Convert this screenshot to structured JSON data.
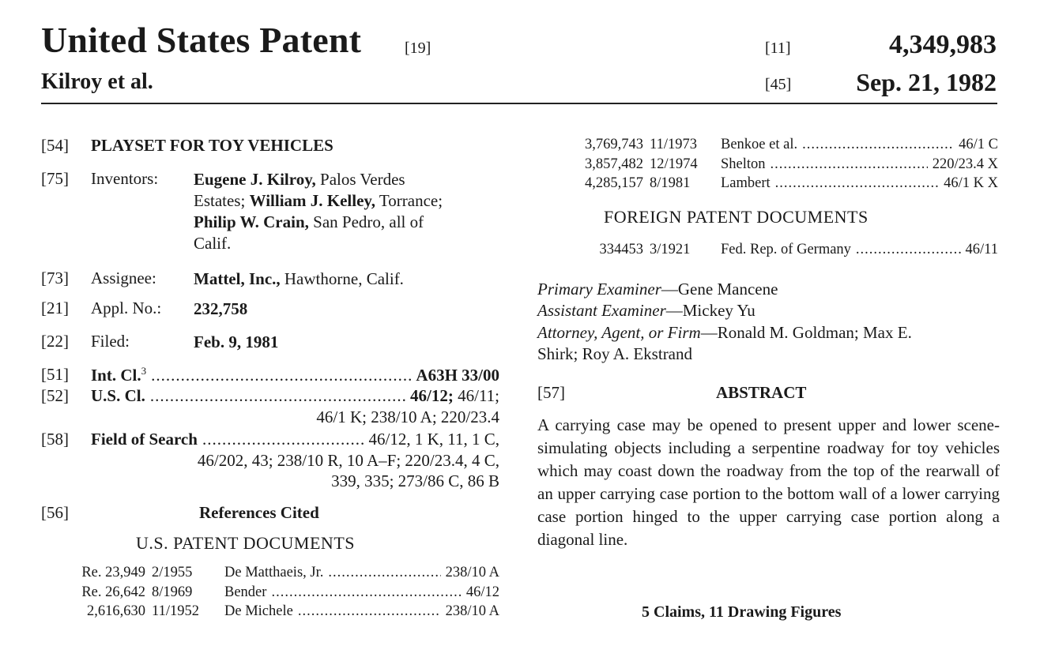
{
  "header": {
    "title": "United States Patent",
    "title_code": "[19]",
    "inventor_short": "Kilroy et al.",
    "code_11": "[11]",
    "patent_number": "4,349,983",
    "code_45": "[45]",
    "patent_date": "Sep. 21, 1982"
  },
  "fields": {
    "title": {
      "code": "[54]",
      "text": "PLAYSET FOR TOY VEHICLES"
    },
    "inventors": {
      "code": "[75]",
      "label": "Inventors:",
      "n1": "Eugene J. Kilroy,",
      "t1": " Palos Verdes",
      "t2": "Estates; ",
      "n2": "William J. Kelley,",
      "t3": " Torrance;",
      "n3": "Philip W. Crain,",
      "t4": " San Pedro, all of",
      "t5": "Calif."
    },
    "assignee": {
      "code": "[73]",
      "label": "Assignee:",
      "name": "Mattel, Inc.,",
      "rest": " Hawthorne, Calif."
    },
    "appl_no": {
      "code": "[21]",
      "label": "Appl. No.:",
      "value": "232,758"
    },
    "filed": {
      "code": "[22]",
      "label": "Filed:",
      "value": "Feb. 9, 1981"
    },
    "int_cl": {
      "code": "[51]",
      "label": "Int. Cl.",
      "sup": "3",
      "value": "A63H 33/00"
    },
    "us_cl": {
      "code": "[52]",
      "label": "U.S. Cl.",
      "value_bold": "46/12;",
      "value_rest": " 46/11;",
      "line2": "46/1 K; 238/10 A; 220/23.4"
    },
    "search": {
      "code": "[58]",
      "label": "Field of Search",
      "value": "46/12, 1 K, 11, 1 C,",
      "line2": "46/202, 43; 238/10 R, 10 A–F; 220/23.4, 4 C,",
      "line3": "339, 335; 273/86 C, 86 B"
    },
    "refs": {
      "code": "[56]",
      "heading": "References Cited",
      "subheading": "U.S. PATENT DOCUMENTS"
    }
  },
  "us_refs": [
    {
      "number": "Re. 23,949",
      "date": "2/1955",
      "name": "De Matthaeis, Jr.",
      "cls": "238/10 A"
    },
    {
      "number": "Re. 26,642",
      "date": "8/1969",
      "name": "Bender",
      "cls": "46/12"
    },
    {
      "number": "2,616,630",
      "date": "11/1952",
      "name": "De Michele",
      "cls": "238/10 A"
    }
  ],
  "us_refs_cont": [
    {
      "number": "3,769,743",
      "date": "11/1973",
      "name": "Benkoe et al.",
      "cls": "46/1 C"
    },
    {
      "number": "3,857,482",
      "date": "12/1974",
      "name": "Shelton",
      "cls": "220/23.4 X"
    },
    {
      "number": "4,285,157",
      "date": "8/1981",
      "name": "Lambert",
      "cls": "46/1 K X"
    }
  ],
  "foreign": {
    "heading": "FOREIGN PATENT DOCUMENTS",
    "rows": [
      {
        "number": "334453",
        "date": "3/1921",
        "name": "Fed. Rep. of Germany",
        "cls": "46/11"
      }
    ]
  },
  "examiners": {
    "primary_label": "Primary Examiner",
    "primary_name": "—Gene Mancene",
    "assistant_label": "Assistant Examiner",
    "assistant_name": "—Mickey Yu",
    "attorney_label": "Attorney, Agent, or Firm",
    "attorney_name": "—Ronald M. Goldman; Max E.",
    "attorney_line2": "Shirk; Roy A. Ekstrand"
  },
  "abstract": {
    "code": "[57]",
    "heading": "ABSTRACT",
    "text": "A carrying case may be opened to present upper and lower scene-simulating objects including a serpentine roadway for toy vehicles which may coast down the roadway from the top of the rearwall of an upper carrying case portion to the bottom wall of a lower carrying case portion hinged to the upper carrying case portion along a diagonal line."
  },
  "claims_line": "5 Claims, 11 Drawing Figures"
}
